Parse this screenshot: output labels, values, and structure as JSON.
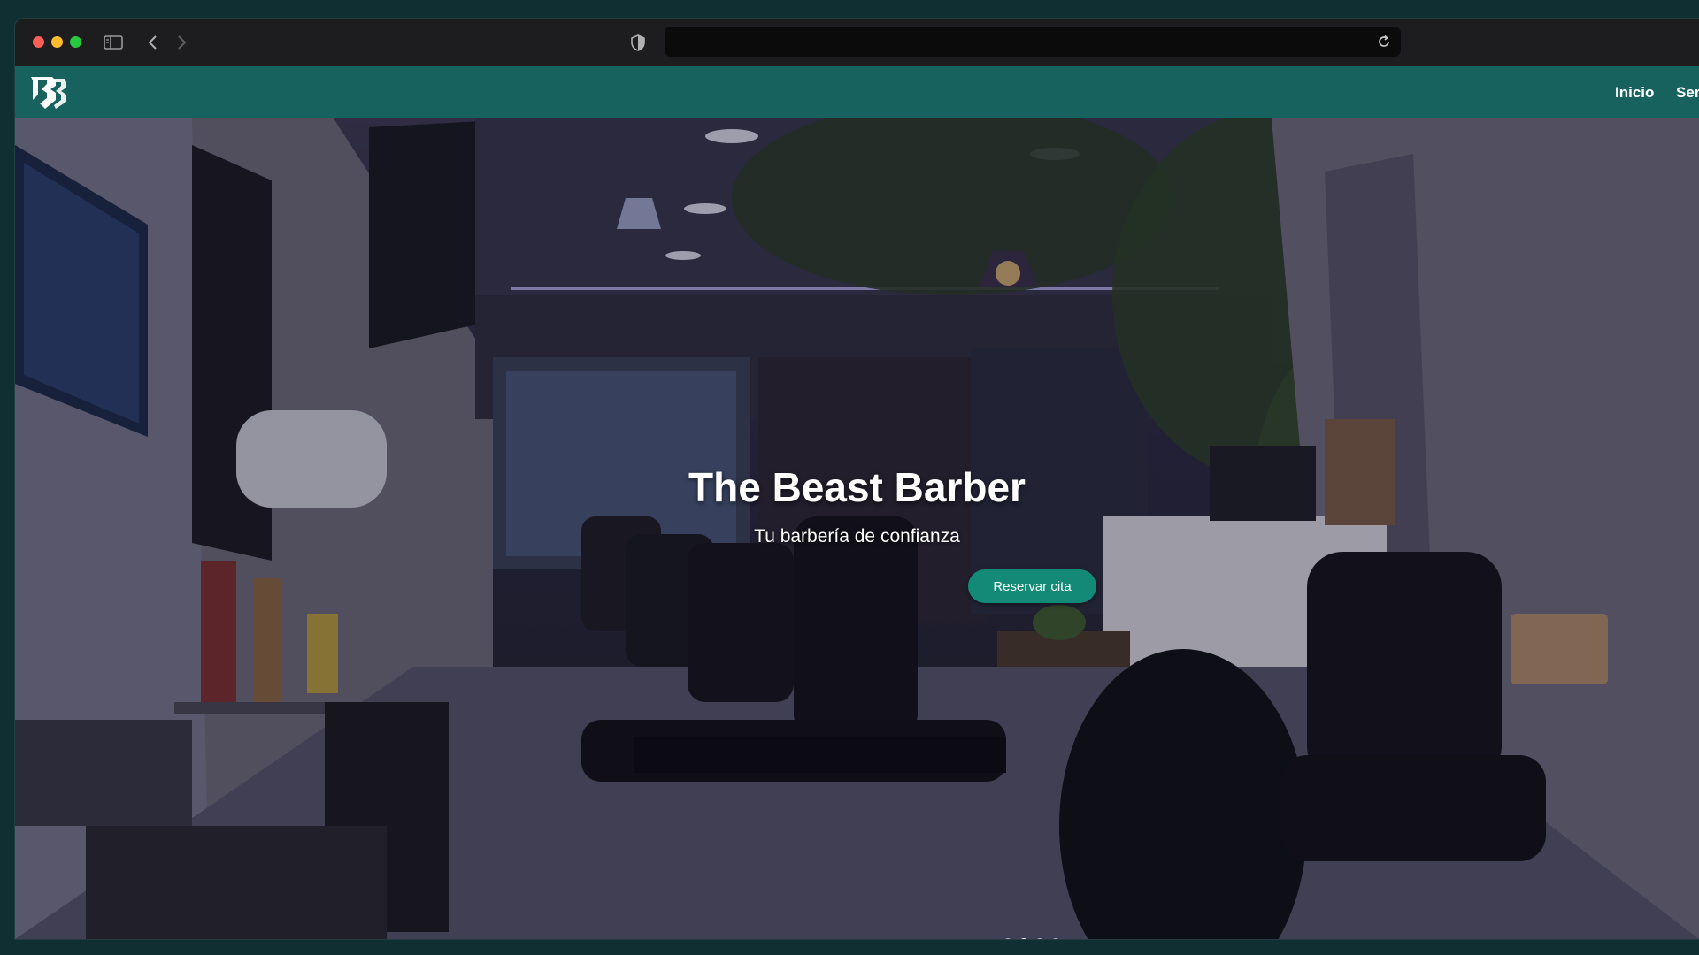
{
  "browser": {
    "url": "",
    "icons": [
      "sidebar-toggle-icon",
      "back-arrow-icon",
      "forward-arrow-icon",
      "shield-icon",
      "reload-icon"
    ]
  },
  "site": {
    "logo_text": "TBB",
    "nav": [
      {
        "label": "Inicio"
      },
      {
        "label": "Ser"
      }
    ],
    "colors": {
      "nav_bg": "#17625f",
      "button_bg": "#138a77"
    }
  },
  "hero": {
    "title": "The Beast Barber",
    "subtitle": "Tu barbería de confianza",
    "cta_label": "Reservar cita",
    "slides_total": 4,
    "active_slide": 2
  }
}
